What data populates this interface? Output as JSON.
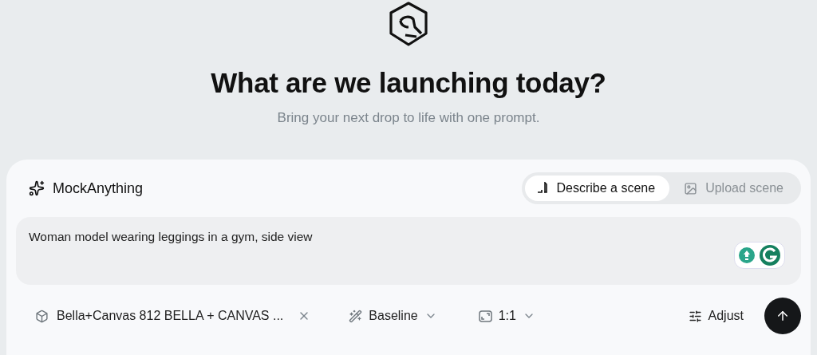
{
  "hero": {
    "title": "What are we launching today?",
    "subtitle": "Bring your next drop to life with one prompt."
  },
  "composer": {
    "brand": "MockAnything",
    "tabs": [
      {
        "label": "Describe a scene",
        "selected": true
      },
      {
        "label": "Upload scene",
        "selected": false
      }
    ],
    "prompt": {
      "value": "Woman model wearing leggings in a gym, side view"
    },
    "product": {
      "label": "Bella+Canvas 812 BELLA + CANVAS ..."
    },
    "style": {
      "label": "Baseline"
    },
    "ratio": {
      "label": "1:1"
    },
    "adjust": {
      "label": "Adjust"
    }
  }
}
